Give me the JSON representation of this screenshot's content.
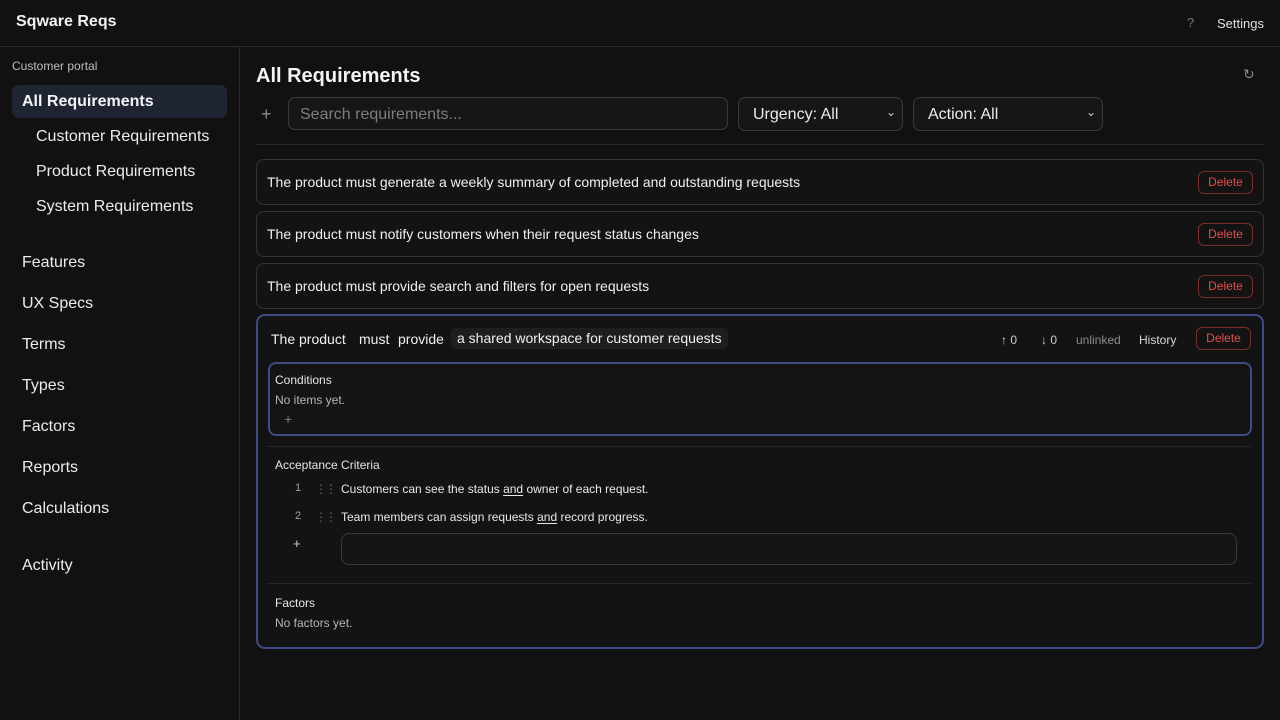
{
  "app": {
    "title": "Sqware Reqs",
    "help_label": "?",
    "settings_label": "Settings"
  },
  "sidebar": {
    "group_label": "Customer portal",
    "active_item": "All Requirements",
    "sub_items": [
      "Customer Requirements",
      "Product Requirements",
      "System Requirements"
    ],
    "items": [
      "Features",
      "UX Specs",
      "Terms",
      "Types",
      "Factors",
      "Reports",
      "Calculations"
    ],
    "activity_label": "Activity"
  },
  "main": {
    "title": "All Requirements",
    "refresh_icon": "↻",
    "add_icon": "+",
    "search_placeholder": "Search requirements...",
    "urgency_filter": "Urgency: All",
    "action_filter": "Action: All",
    "requirements": [
      {
        "text": "The product must generate a weekly summary of completed and outstanding requests",
        "delete_label": "Delete"
      },
      {
        "text": "The product must notify customers when their request status changes",
        "delete_label": "Delete"
      },
      {
        "text": "The product must provide search and filters for open requests",
        "delete_label": "Delete"
      }
    ],
    "expanded": {
      "subject": "The product",
      "modal": "must",
      "verb": "provide",
      "object": "a shared workspace for customer requests",
      "up_count": "↑ 0",
      "down_count": "↓ 0",
      "link_status": "unlinked",
      "history_label": "History",
      "delete_label": "Delete",
      "conditions_title": "Conditions",
      "conditions_empty": "No items yet.",
      "add_icon": "+",
      "criteria_title": "Acceptance Criteria",
      "criteria": [
        {
          "num": "1",
          "pre": "Customers can see the status ",
          "and": "and",
          "post": " owner of each request."
        },
        {
          "num": "2",
          "pre": "Team members can assign requests ",
          "and": "and",
          "post": " record progress."
        }
      ],
      "criteria_add_icon": "+",
      "factors_title": "Factors",
      "factors_empty": "No factors yet."
    }
  }
}
